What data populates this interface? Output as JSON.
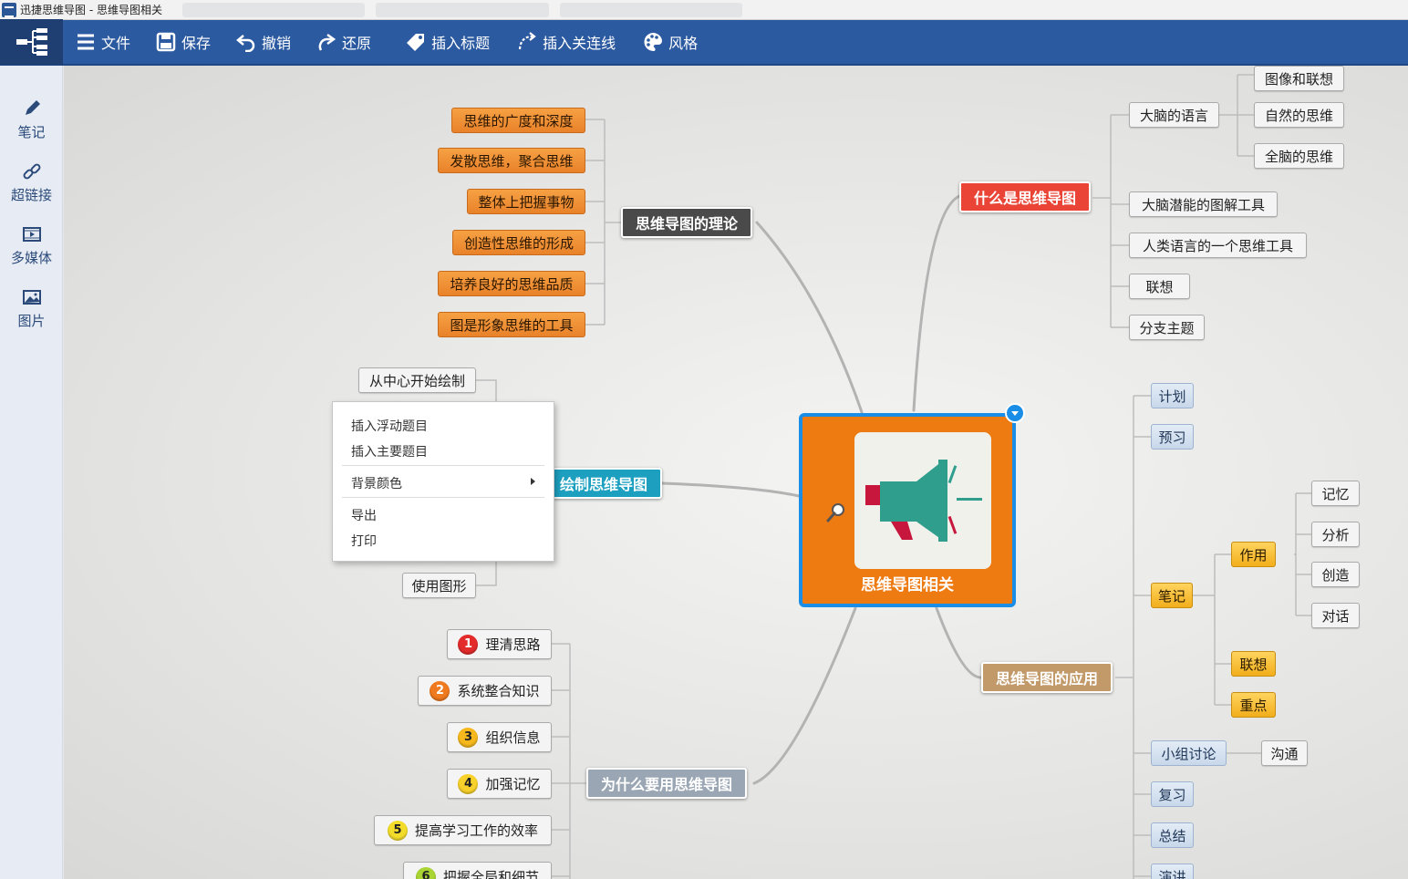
{
  "window": {
    "title": "迅捷思维导图 - 思维导图相关"
  },
  "toolbar": {
    "file": "文件",
    "save": "保存",
    "undo": "撤销",
    "redo": "还原",
    "insert_topic": "插入标题",
    "insert_relation": "插入关连线",
    "style": "风格"
  },
  "sidebar": {
    "note": "笔记",
    "hyperlink": "超链接",
    "media": "多媒体",
    "image": "图片"
  },
  "central": {
    "label": "思维导图相关"
  },
  "theory": {
    "label": "思维导图的理论",
    "children": [
      "思维的广度和深度",
      "发散思维，聚合思维",
      "整体上把握事物",
      "创造性思维的形成",
      "培养良好的思维品质",
      "图是形象思维的工具"
    ]
  },
  "what": {
    "label": "什么是思维导图",
    "brain_language": "大脑的语言",
    "brain_language_children": [
      "图像和联想",
      "自然的思维",
      "全脑的思维"
    ],
    "children": [
      "大脑潜能的图解工具",
      "人类语言的一个思维工具",
      "联想",
      "分支主题"
    ]
  },
  "draw": {
    "label": "绘制思维导图",
    "children": [
      "从中心开始绘制",
      "使用图形"
    ]
  },
  "why": {
    "label": "为什么要用思维导图",
    "children": [
      {
        "num": "1",
        "text": "理清思路"
      },
      {
        "num": "2",
        "text": "系统整合知识"
      },
      {
        "num": "3",
        "text": "组织信息"
      },
      {
        "num": "4",
        "text": "加强记忆"
      },
      {
        "num": "5",
        "text": "提高学习工作的效率"
      },
      {
        "num": "6",
        "text": "把握全局和细节"
      }
    ]
  },
  "apply": {
    "label": "思维导图的应用",
    "plan": "计划",
    "preview": "预习",
    "notes": "笔记",
    "notes_children": {
      "role": "作用",
      "association": "联想",
      "key": "重点"
    },
    "role_children": [
      "记忆",
      "分析",
      "创造",
      "对话"
    ],
    "group": "小组讨论",
    "communicate": "沟通",
    "review": "复习",
    "summary": "总结",
    "speech": "演讲"
  },
  "context_menu": {
    "insert_floating": "插入浮动题目",
    "insert_main": "插入主要题目",
    "background_color": "背景颜色",
    "export": "导出",
    "print": "打印"
  }
}
